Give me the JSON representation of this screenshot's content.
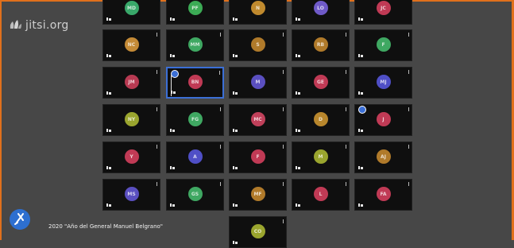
{
  "logo": {
    "text": "jitsi.org"
  },
  "footer": {
    "text": "2020 \"Año del General Manuel Belgrano\""
  },
  "colors": {
    "accent": "#3b6fd6",
    "tile_bg": "#0f0f0f",
    "stage_bg": "#474747"
  },
  "participants": [
    {
      "initials": "MD",
      "color": "#39a86a"
    },
    {
      "initials": "PF",
      "color": "#3cab55"
    },
    {
      "initials": "N",
      "color": "#c08a2e"
    },
    {
      "initials": "LO",
      "color": "#6f5ac8"
    },
    {
      "initials": "JC",
      "color": "#c03a55"
    },
    {
      "initials": "NC",
      "color": "#c48a36"
    },
    {
      "initials": "MM",
      "color": "#3fa862"
    },
    {
      "initials": "S",
      "color": "#b07a2a"
    },
    {
      "initials": "RB",
      "color": "#b07a2a"
    },
    {
      "initials": "F",
      "color": "#3fa862"
    },
    {
      "initials": "JM",
      "color": "#b83a52"
    },
    {
      "initials": "BN",
      "color": "#c03a55",
      "active": true,
      "hand_raised": true
    },
    {
      "initials": "M",
      "color": "#5a4fc0"
    },
    {
      "initials": "GE",
      "color": "#c03a55"
    },
    {
      "initials": "MJ",
      "color": "#4f4fc6"
    },
    {
      "initials": "NY",
      "color": "#9aa52e"
    },
    {
      "initials": "FG",
      "color": "#3fa862"
    },
    {
      "initials": "MC",
      "color": "#c0405a"
    },
    {
      "initials": "D",
      "color": "#b8862c"
    },
    {
      "initials": "J",
      "color": "#c03a55",
      "hand_raised": true
    },
    {
      "initials": "Y",
      "color": "#c03a55"
    },
    {
      "initials": "A",
      "color": "#4f4fc6"
    },
    {
      "initials": "F",
      "color": "#c03a55"
    },
    {
      "initials": "M",
      "color": "#9aa52e"
    },
    {
      "initials": "AJ",
      "color": "#b07a2a"
    },
    {
      "initials": "MS",
      "color": "#5a4fc0"
    },
    {
      "initials": "GS",
      "color": "#3fa862"
    },
    {
      "initials": "MF",
      "color": "#b07a2a"
    },
    {
      "initials": "L",
      "color": "#c03a55"
    },
    {
      "initials": "FA",
      "color": "#c03a55"
    },
    {
      "initials": "CO",
      "color": "#9aa52e"
    }
  ]
}
